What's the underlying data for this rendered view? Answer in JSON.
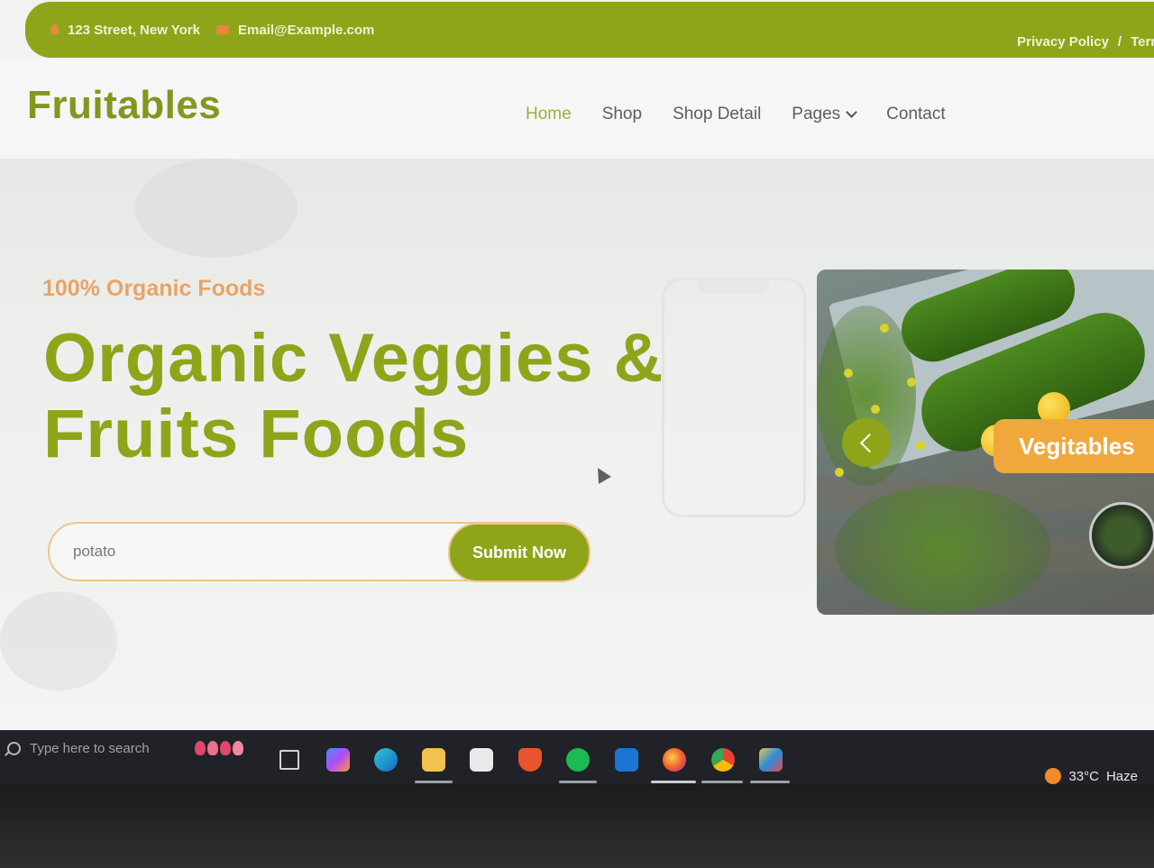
{
  "topbar": {
    "address": "123 Street, New York",
    "email": "Email@Example.com",
    "links": [
      "Privacy Policy",
      "/",
      "Terms"
    ]
  },
  "header": {
    "logo": "Fruitables",
    "nav": [
      {
        "label": "Home",
        "active": true
      },
      {
        "label": "Shop"
      },
      {
        "label": "Shop Detail"
      },
      {
        "label": "Pages"
      },
      {
        "label": "Contact"
      }
    ]
  },
  "hero": {
    "tagline": "100% Organic Foods",
    "headline_line1": "Organic Veggies &",
    "headline_line2": "Fruits Foods",
    "search_value": "potato",
    "submit_label": "Submit Now",
    "carousel_badge": "Vegitables"
  },
  "taskbar": {
    "search_placeholder": "Type here to search",
    "apps": [
      "task-view",
      "copilot",
      "edge",
      "file-explorer",
      "microsoft-store",
      "brave",
      "spotify",
      "outlook",
      "firefox",
      "chrome",
      "app"
    ],
    "weather_temp": "33°C",
    "weather_desc": "Haze"
  },
  "colors": {
    "brand_green": "#8ea51a",
    "accent_orange": "#f0a83d",
    "tagline_orange": "#e7a466"
  }
}
